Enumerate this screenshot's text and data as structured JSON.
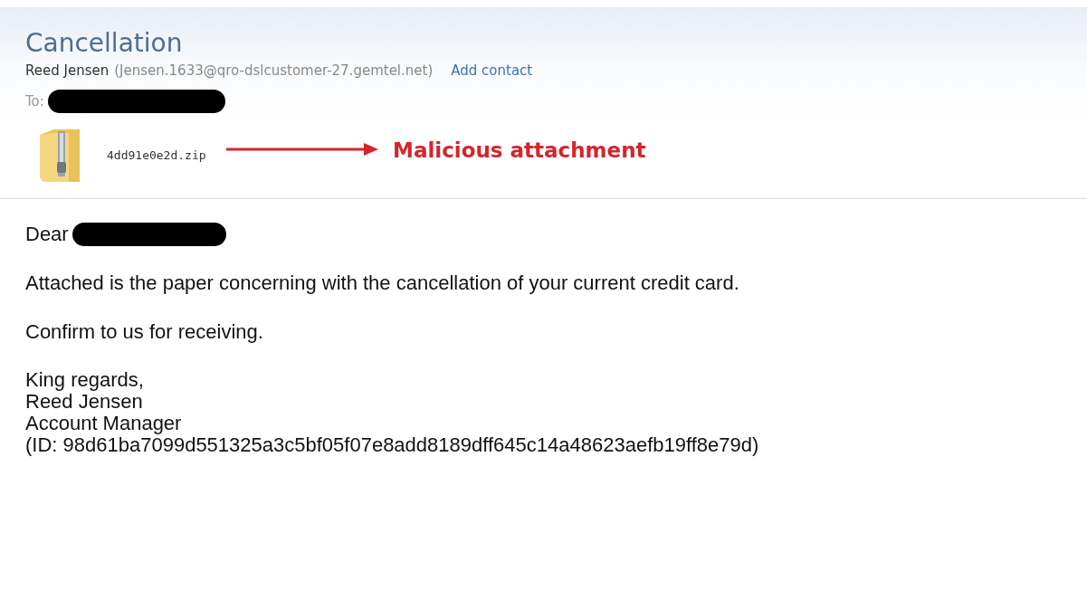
{
  "message": {
    "subject": "Cancellation",
    "sender_name": "Reed Jensen",
    "sender_address": "(Jensen.1633@qro-dslcustomer-27.gemtel.net)",
    "add_contact": "Add contact",
    "to_label": "To:"
  },
  "attachment": {
    "file_name": "4dd91e0e2d.zip"
  },
  "annotation": {
    "label": "Malicious attachment"
  },
  "body": {
    "greeting": "Dear",
    "paragraphs": [
      "Attached is the paper concerning with the cancellation of your current credit card.",
      "Confirm to us for receiving."
    ],
    "signature": [
      "King regards,",
      "Reed Jensen",
      "Account Manager",
      "(ID: 98d61ba7099d551325a3c5bf05f07e8add8189dff645c14a48623aefb19ff8e79d)"
    ]
  }
}
